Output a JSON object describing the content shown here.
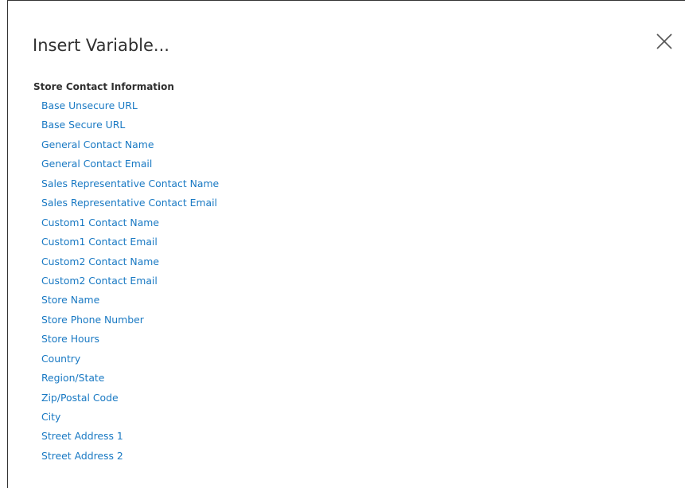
{
  "dialog": {
    "title": "Insert Variable...",
    "close_icon": "close-icon"
  },
  "section": {
    "title": "Store Contact Information",
    "items": [
      {
        "label": "Base Unsecure URL"
      },
      {
        "label": "Base Secure URL"
      },
      {
        "label": "General Contact Name"
      },
      {
        "label": "General Contact Email"
      },
      {
        "label": "Sales Representative Contact Name"
      },
      {
        "label": "Sales Representative Contact Email"
      },
      {
        "label": "Custom1 Contact Name"
      },
      {
        "label": "Custom1 Contact Email"
      },
      {
        "label": "Custom2 Contact Name"
      },
      {
        "label": "Custom2 Contact Email"
      },
      {
        "label": "Store Name"
      },
      {
        "label": "Store Phone Number"
      },
      {
        "label": "Store Hours"
      },
      {
        "label": "Country"
      },
      {
        "label": "Region/State"
      },
      {
        "label": "Zip/Postal Code"
      },
      {
        "label": "City"
      },
      {
        "label": "Street Address 1"
      },
      {
        "label": "Street Address 2"
      }
    ]
  },
  "colors": {
    "link": "#1979c3",
    "text": "#303030",
    "border": "#333333"
  }
}
